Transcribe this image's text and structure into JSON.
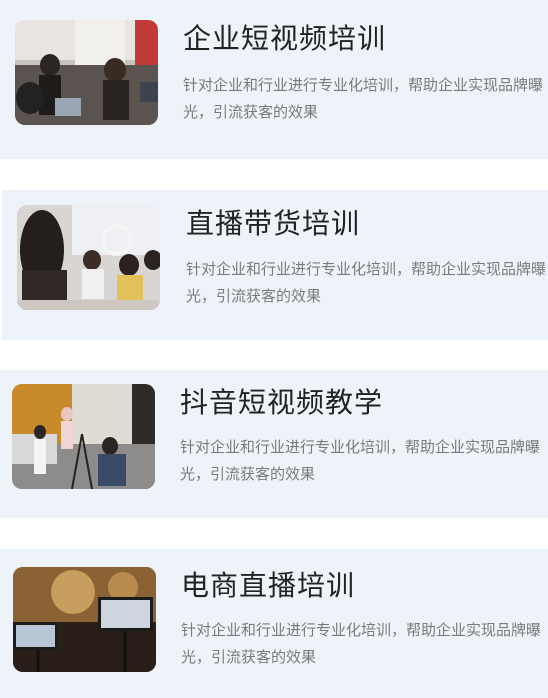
{
  "courses": [
    {
      "title": "企业短视频培训",
      "description": "针对企业和行业进行专业化培训，帮助企业实现品牌曝光，引流获客的效果"
    },
    {
      "title": "直播带货培训",
      "description": "针对企业和行业进行专业化培训，帮助企业实现品牌曝光，引流获客的效果"
    },
    {
      "title": "抖音短视频教学",
      "description": "针对企业和行业进行专业化培训，帮助企业实现品牌曝光，引流获客的效果"
    },
    {
      "title": "电商直播培训",
      "description": "针对企业和行业进行专业化培训，帮助企业实现品牌曝光，引流获客的效果"
    }
  ],
  "colors": {
    "card_background": "#eef2f9",
    "title": "#222222",
    "description": "#7a7a7a"
  }
}
